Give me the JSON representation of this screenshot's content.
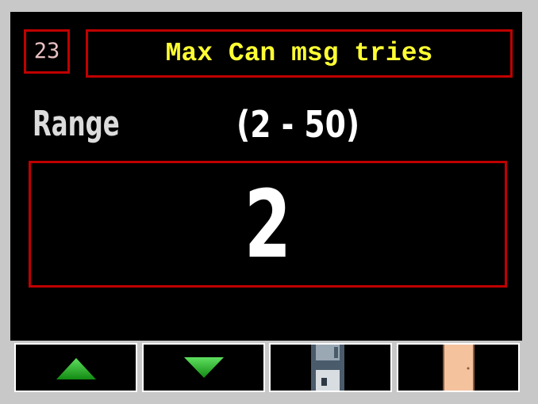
{
  "parameter": {
    "id": "23",
    "title": "Max Can msg tries"
  },
  "range": {
    "label": "Range",
    "value": "(2 - 50)"
  },
  "current_value": "2",
  "toolbar": {
    "buttons": [
      {
        "icon": "arrow-up-icon",
        "color": "#1fa01f"
      },
      {
        "icon": "arrow-down-icon",
        "color": "#1fa01f"
      },
      {
        "icon": "floppy-disk-icon",
        "color": "#4a5b6b"
      },
      {
        "icon": "door-icon",
        "color": "#f5c29e"
      }
    ]
  }
}
